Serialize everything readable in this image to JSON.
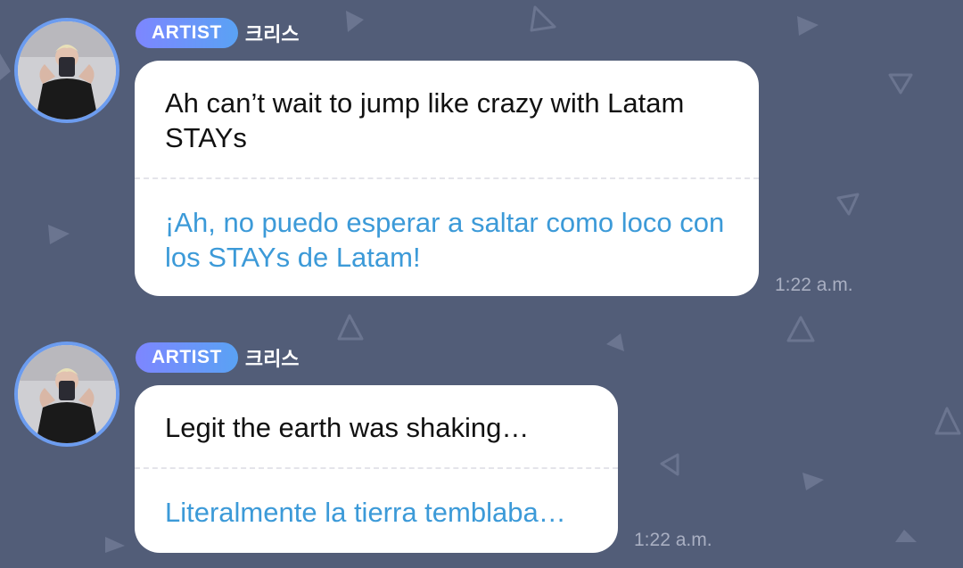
{
  "colors": {
    "background": "#525d78",
    "badge_gradient_start": "#7d86ff",
    "badge_gradient_end": "#5aa2f4",
    "translation_text": "#3c9ad8",
    "avatar_ring": "#6c9cef",
    "timestamp_text": "#a9afc2"
  },
  "messages": [
    {
      "role_badge": "ARTIST",
      "sender": "크리스",
      "original": "Ah can’t wait to jump like crazy with Latam STAYs",
      "translation": "¡Ah, no puedo esperar a saltar como loco con los STAYs de Latam!",
      "time": "1:22 a.m.",
      "avatar_icon": "avatar-photo"
    },
    {
      "role_badge": "ARTIST",
      "sender": "크리스",
      "original": "Legit the earth was shaking…",
      "translation": "Literalmente la tierra temblaba…",
      "time": "1:22 a.m.",
      "avatar_icon": "avatar-photo"
    }
  ]
}
